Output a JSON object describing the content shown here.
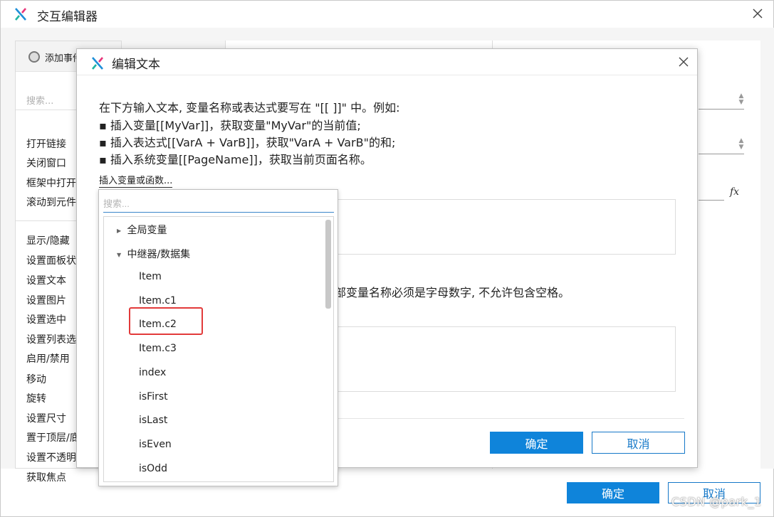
{
  "outer": {
    "title": "交互编辑器",
    "add_event_label": "添加事件",
    "search_placeholder": "搜索...",
    "actions_group1": [
      "打开链接",
      "关闭窗口",
      "框架中打开",
      "滚动到元件"
    ],
    "actions_group2": [
      "显示/隐藏",
      "设置面板状",
      "设置文本",
      "设置图片",
      "设置选中",
      "设置列表选",
      "启用/禁用",
      "移动",
      "旋转",
      "设置尺寸",
      "置于顶层/底",
      "设置不透明",
      "获取焦点"
    ],
    "fx_label": "fx",
    "ok": "确定",
    "cancel": "取消",
    "watermark": "CSDN @park_1"
  },
  "dialog": {
    "title": "编辑文本",
    "instructions": [
      "在下方输入文本, 变量名称或表达式要写在 \"[[ ]]\" 中。例如:",
      "▪ 插入变量[[MyVar]]，获取变量\"MyVar\"的当前值;",
      "▪ 插入表达式[[VarA + VarB]]，获取\"VarA + VarB\"的和;",
      "▪ 插入系统变量[[PageName]]，获取当前页面名称。"
    ],
    "insert_link": "插入变量或函数...",
    "local_var_note": "部变量名称必须是字母数字, 不允许包含空格。",
    "ok": "确定",
    "cancel": "取消"
  },
  "popup": {
    "search_placeholder": "搜索...",
    "nodes": [
      {
        "label": "全局变量",
        "caret": "▶"
      },
      {
        "label": "中继器/数据集",
        "caret": "▼"
      },
      {
        "label": "Item"
      },
      {
        "label": "Item.c1"
      },
      {
        "label": "Item.c2"
      },
      {
        "label": "Item.c3"
      },
      {
        "label": "index"
      },
      {
        "label": "isFirst"
      },
      {
        "label": "isLast"
      },
      {
        "label": "isEven"
      },
      {
        "label": "isOdd"
      }
    ]
  },
  "colors": {
    "accent": "#0f84da",
    "highlight": "#e23a3a"
  }
}
